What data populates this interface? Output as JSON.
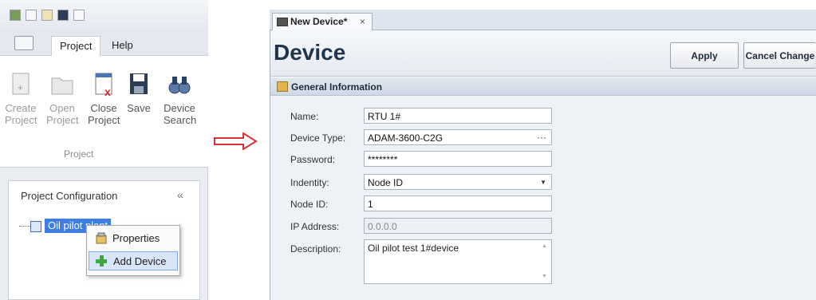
{
  "ribbon": {
    "tabs": [
      "Project",
      "Help"
    ],
    "buttons": [
      {
        "label": "Create Project"
      },
      {
        "label": "Open Project"
      },
      {
        "label": "Close Project"
      },
      {
        "label": "Save"
      },
      {
        "label": "Device Search"
      }
    ],
    "group_label": "Project"
  },
  "config_panel": {
    "title": "Project Configuration",
    "collapse_glyph": "«",
    "tree_node": "Oil pilot plant"
  },
  "context_menu": {
    "items": [
      {
        "label": "Properties",
        "icon": "properties-icon"
      },
      {
        "label": "Add Device",
        "icon": "add-icon"
      }
    ]
  },
  "document": {
    "tab_label": "New Device*",
    "tab_close": "×",
    "title": "Device",
    "apply_label": "Apply",
    "cancel_label": "Cancel Change",
    "section_title": "General Information"
  },
  "form": {
    "name_label": "Name:",
    "name_value": "RTU 1#",
    "device_type_label": "Device Type:",
    "device_type_value": "ADAM-3600-C2G",
    "device_type_button": "···",
    "password_label": "Password:",
    "password_value": "********",
    "identity_label": "Indentity:",
    "identity_value": "Node ID",
    "identity_caret": "▼",
    "node_id_label": "Node ID:",
    "node_id_value": "1",
    "ip_label": "IP Address:",
    "ip_value": "0.0.0.0",
    "description_label": "Description:",
    "description_value": "Oil pilot test 1#device"
  },
  "colors": {
    "accent": "#3d7ee0",
    "title": "#1e3550",
    "arrow": "#d9303a"
  }
}
